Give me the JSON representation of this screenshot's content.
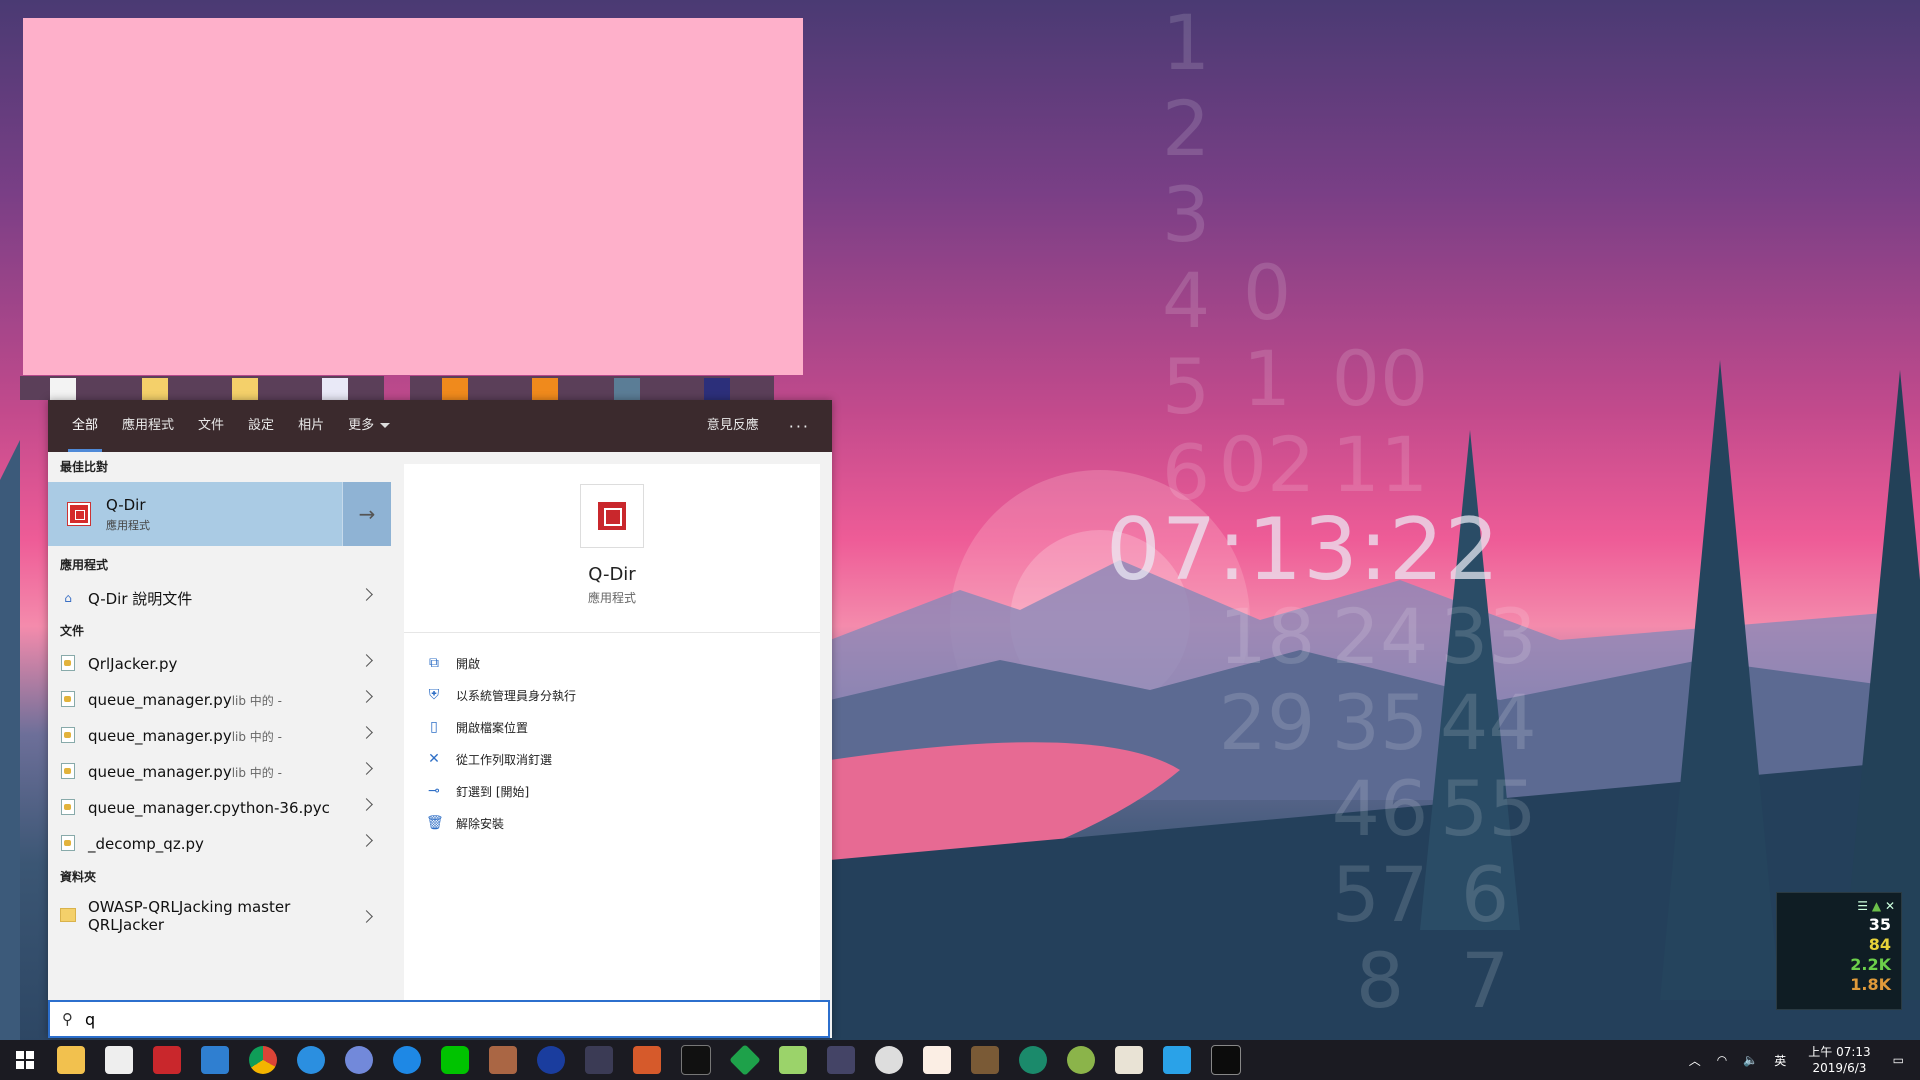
{
  "wallpaper": {
    "clock_time": "07:13:22",
    "hour_col": [
      "1",
      "2",
      "3",
      "4",
      "5",
      "6"
    ],
    "min_col": [
      "0",
      "1",
      "02",
      "18",
      "29"
    ],
    "sec_col": [
      "00",
      "11",
      "24",
      "35",
      "46",
      "57",
      "8"
    ],
    "sec2_col": [
      "33",
      "44",
      "55",
      "6",
      "7"
    ]
  },
  "tabs": {
    "items": [
      "全部",
      "應用程式",
      "文件",
      "設定",
      "相片"
    ],
    "more": "更多",
    "feedback": "意見反應",
    "options": "···"
  },
  "best_match": {
    "header": "最佳比對",
    "name": "Q-Dir",
    "type": "應用程式",
    "open_arrow": "→"
  },
  "apps": {
    "header": "應用程式",
    "items": [
      {
        "name": "Q-Dir 說明文件"
      }
    ]
  },
  "documents": {
    "header": "文件",
    "items": [
      {
        "name": "QrlJacker.py",
        "sub": ""
      },
      {
        "name": "queue_manager.py",
        "sub": "lib 中的 -"
      },
      {
        "name": "queue_manager.py",
        "sub": "lib 中的 -"
      },
      {
        "name": "queue_manager.py",
        "sub": "lib 中的 -"
      },
      {
        "name": "queue_manager.cpython-36.pyc",
        "sub": ""
      },
      {
        "name": "_decomp_qz.py",
        "sub": ""
      }
    ]
  },
  "folders": {
    "header": "資料夾",
    "items": [
      {
        "line1": "OWASP-QRLJacking master",
        "line2": "QRLJacker"
      }
    ]
  },
  "preview": {
    "title": "Q-Dir",
    "subtitle": "應用程式",
    "actions": [
      {
        "icon": "open-icon",
        "label": "開啟"
      },
      {
        "icon": "run-as-admin-icon",
        "label": "以系統管理員身分執行"
      },
      {
        "icon": "file-location-icon",
        "label": "開啟檔案位置"
      },
      {
        "icon": "unpin-taskbar-icon",
        "label": "從工作列取消釘選"
      },
      {
        "icon": "pin-start-icon",
        "label": "釘選到 [開始]"
      },
      {
        "icon": "uninstall-icon",
        "label": "解除安裝"
      }
    ]
  },
  "search": {
    "value": "q",
    "icon": "search-icon"
  },
  "tray": {
    "ime": "英",
    "time": "上午 07:13",
    "date": "2019/6/3"
  },
  "widget": {
    "v1": "35",
    "v2": "84",
    "v3": "2.2K",
    "v4": "1.8K"
  },
  "colors": {
    "accent": "#2c6fcd",
    "best_bg": "#aacbe4",
    "tab_bar": "#3b2a2d",
    "pink_block": "#feb0ca"
  }
}
